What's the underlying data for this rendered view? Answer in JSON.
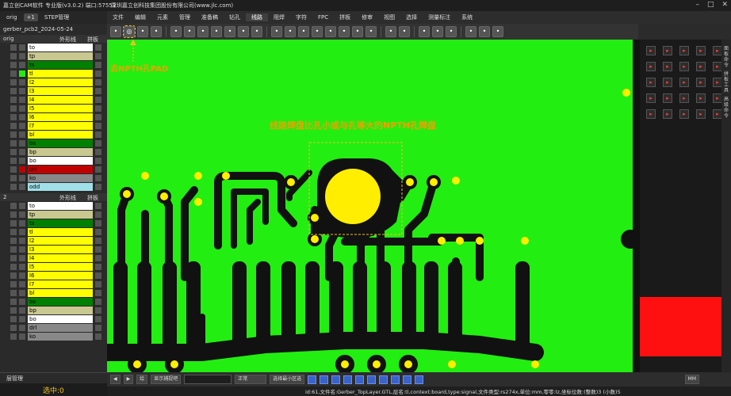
{
  "window": {
    "title": "嘉立创CAM软件 专业版(v3.0.2) 端口:57552",
    "company": "深圳嘉立创科技集团股份有限公司(www.jlc.com)"
  },
  "top_tabs": [
    "orig",
    "+1",
    "STEP管理"
  ],
  "menu": [
    "文件",
    "编辑",
    "元素",
    "管理",
    "准备稿",
    "钻孔",
    "线路",
    "阻焊",
    "字符",
    "FPC",
    "拼板",
    "修审",
    "视图",
    "选择",
    "测量标注",
    "系统"
  ],
  "menu_active_index": 6,
  "job": {
    "name": "gerber_pcb2_2024-05-24"
  },
  "groups": [
    {
      "name": "orig",
      "option1": "外形线",
      "option2": "拼板",
      "layers": [
        {
          "name": "to",
          "color": "#ffffff",
          "mark": "#555555"
        },
        {
          "name": "tp",
          "color": "#c8c890",
          "mark": "#555555"
        },
        {
          "name": "ts",
          "color": "#008000",
          "mark": "#555555"
        },
        {
          "name": "tl",
          "color": "#ffff00",
          "mark": "#22ee11"
        },
        {
          "name": "l2",
          "color": "#ffff00",
          "mark": "#555555"
        },
        {
          "name": "l3",
          "color": "#ffff00",
          "mark": "#555555"
        },
        {
          "name": "l4",
          "color": "#ffff00",
          "mark": "#555555"
        },
        {
          "name": "l5",
          "color": "#ffff00",
          "mark": "#555555"
        },
        {
          "name": "l6",
          "color": "#ffff00",
          "mark": "#555555"
        },
        {
          "name": "l7",
          "color": "#ffff00",
          "mark": "#555555"
        },
        {
          "name": "bl",
          "color": "#ffff00",
          "mark": "#555555"
        },
        {
          "name": "bs",
          "color": "#008000",
          "mark": "#555555"
        },
        {
          "name": "bp",
          "color": "#c8c890",
          "mark": "#555555"
        },
        {
          "name": "bo",
          "color": "#ffffff",
          "mark": "#555555"
        },
        {
          "name": "drl",
          "color": "#c00000",
          "mark": "#c00000"
        },
        {
          "name": "ko",
          "color": "#888888",
          "mark": "#555555"
        },
        {
          "name": "odd",
          "color": "#a0e0e8",
          "mark": "#555555"
        }
      ]
    },
    {
      "name": "2",
      "option1": "外形线",
      "option2": "拼板",
      "layers": [
        {
          "name": "to",
          "color": "#ffffff",
          "mark": "#555555"
        },
        {
          "name": "tp",
          "color": "#c8c890",
          "mark": "#555555"
        },
        {
          "name": "ts",
          "color": "#008000",
          "mark": "#555555"
        },
        {
          "name": "tl",
          "color": "#ffff00",
          "mark": "#555555"
        },
        {
          "name": "l2",
          "color": "#ffff00",
          "mark": "#555555"
        },
        {
          "name": "l3",
          "color": "#ffff00",
          "mark": "#555555"
        },
        {
          "name": "l4",
          "color": "#ffff00",
          "mark": "#555555"
        },
        {
          "name": "l5",
          "color": "#ffff00",
          "mark": "#555555"
        },
        {
          "name": "l6",
          "color": "#ffff00",
          "mark": "#555555"
        },
        {
          "name": "l7",
          "color": "#ffff00",
          "mark": "#555555"
        },
        {
          "name": "bl",
          "color": "#ffff00",
          "mark": "#555555"
        },
        {
          "name": "bs",
          "color": "#008000",
          "mark": "#555555"
        },
        {
          "name": "bp",
          "color": "#c8c890",
          "mark": "#555555"
        },
        {
          "name": "bo",
          "color": "#ffffff",
          "mark": "#555555"
        },
        {
          "name": "drl",
          "color": "#888888",
          "mark": "#555555"
        },
        {
          "name": "ko",
          "color": "#888888",
          "mark": "#555555"
        }
      ]
    }
  ],
  "layer_tab": "层管理",
  "selection": {
    "label": "选中:0"
  },
  "annotations": {
    "tool_tip": "去NPTH孔PAD",
    "pad_note": "线路焊盘比孔小或与孔等大的NPTH孔焊盘"
  },
  "bottom": {
    "mode": "绘",
    "snap_btn": "显示捕捉吧",
    "layer_select": "正常",
    "sel_btn": "选择最小区选",
    "unit": "MM"
  },
  "status_text": "id:61,文件名:Gerber_TopLayer.GTL,层名:tl,context:board,type:signal,文件类型:rs274x,单位:mm,零零:lz,坐标位数:(整数)3 (小数)5",
  "side_tabs": [
    "面板命令",
    "拼板工具",
    "高级命令"
  ],
  "colors": {
    "board": "#22ee11",
    "copper": "#111111",
    "pad": "#ffee00",
    "accent": "#f0c020"
  }
}
